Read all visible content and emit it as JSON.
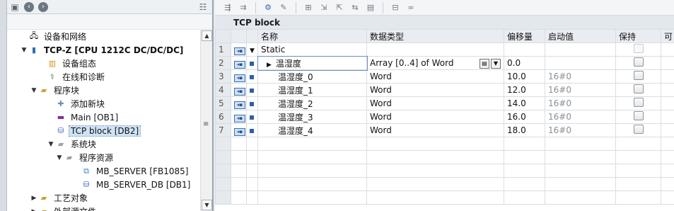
{
  "tree": {
    "items": [
      {
        "label": "设备和网络",
        "icon": "network-icon"
      },
      {
        "label": "TCP-Z [CPU 1212C DC/DC/DC]",
        "icon": "plc-icon"
      },
      {
        "label": "设备组态",
        "icon": "device-config-icon"
      },
      {
        "label": "在线和诊断",
        "icon": "online-diagnostics-icon"
      },
      {
        "label": "程序块",
        "icon": "folder-icon"
      },
      {
        "label": "添加新块",
        "icon": "add-block-icon"
      },
      {
        "label": "Main [OB1]",
        "icon": "ob-block-icon"
      },
      {
        "label": "TCP block [DB2]",
        "icon": "db-block-icon"
      },
      {
        "label": "系统块",
        "icon": "folder-icon"
      },
      {
        "label": "程序资源",
        "icon": "folder-icon"
      },
      {
        "label": "MB_SERVER [FB1085]",
        "icon": "fb-block-icon"
      },
      {
        "label": "MB_SERVER_DB [DB1]",
        "icon": "db-block-icon"
      },
      {
        "label": "工艺对象",
        "icon": "folder-icon"
      },
      {
        "label": "外部源文件",
        "icon": "folder-icon"
      }
    ]
  },
  "editor": {
    "title": "TCP block",
    "columns": [
      "名称",
      "数据类型",
      "偏移量",
      "启动值",
      "保持",
      "可"
    ],
    "rows": [
      {
        "num": "1",
        "name": "Static",
        "type": "",
        "offset": "",
        "start": ""
      },
      {
        "num": "2",
        "name": "温湿度",
        "type": "Array [0..4] of Word",
        "offset": "0.0",
        "start": ""
      },
      {
        "num": "3",
        "name": "温湿度_0",
        "type": "Word",
        "offset": "10.0",
        "start": "16#0"
      },
      {
        "num": "4",
        "name": "温湿度_1",
        "type": "Word",
        "offset": "12.0",
        "start": "16#0"
      },
      {
        "num": "5",
        "name": "温湿度_2",
        "type": "Word",
        "offset": "14.0",
        "start": "16#0"
      },
      {
        "num": "6",
        "name": "温湿度_3",
        "type": "Word",
        "offset": "16.0",
        "start": "16#0"
      },
      {
        "num": "7",
        "name": "温湿度_4",
        "type": "Word",
        "offset": "18.0",
        "start": "16#0"
      }
    ]
  }
}
